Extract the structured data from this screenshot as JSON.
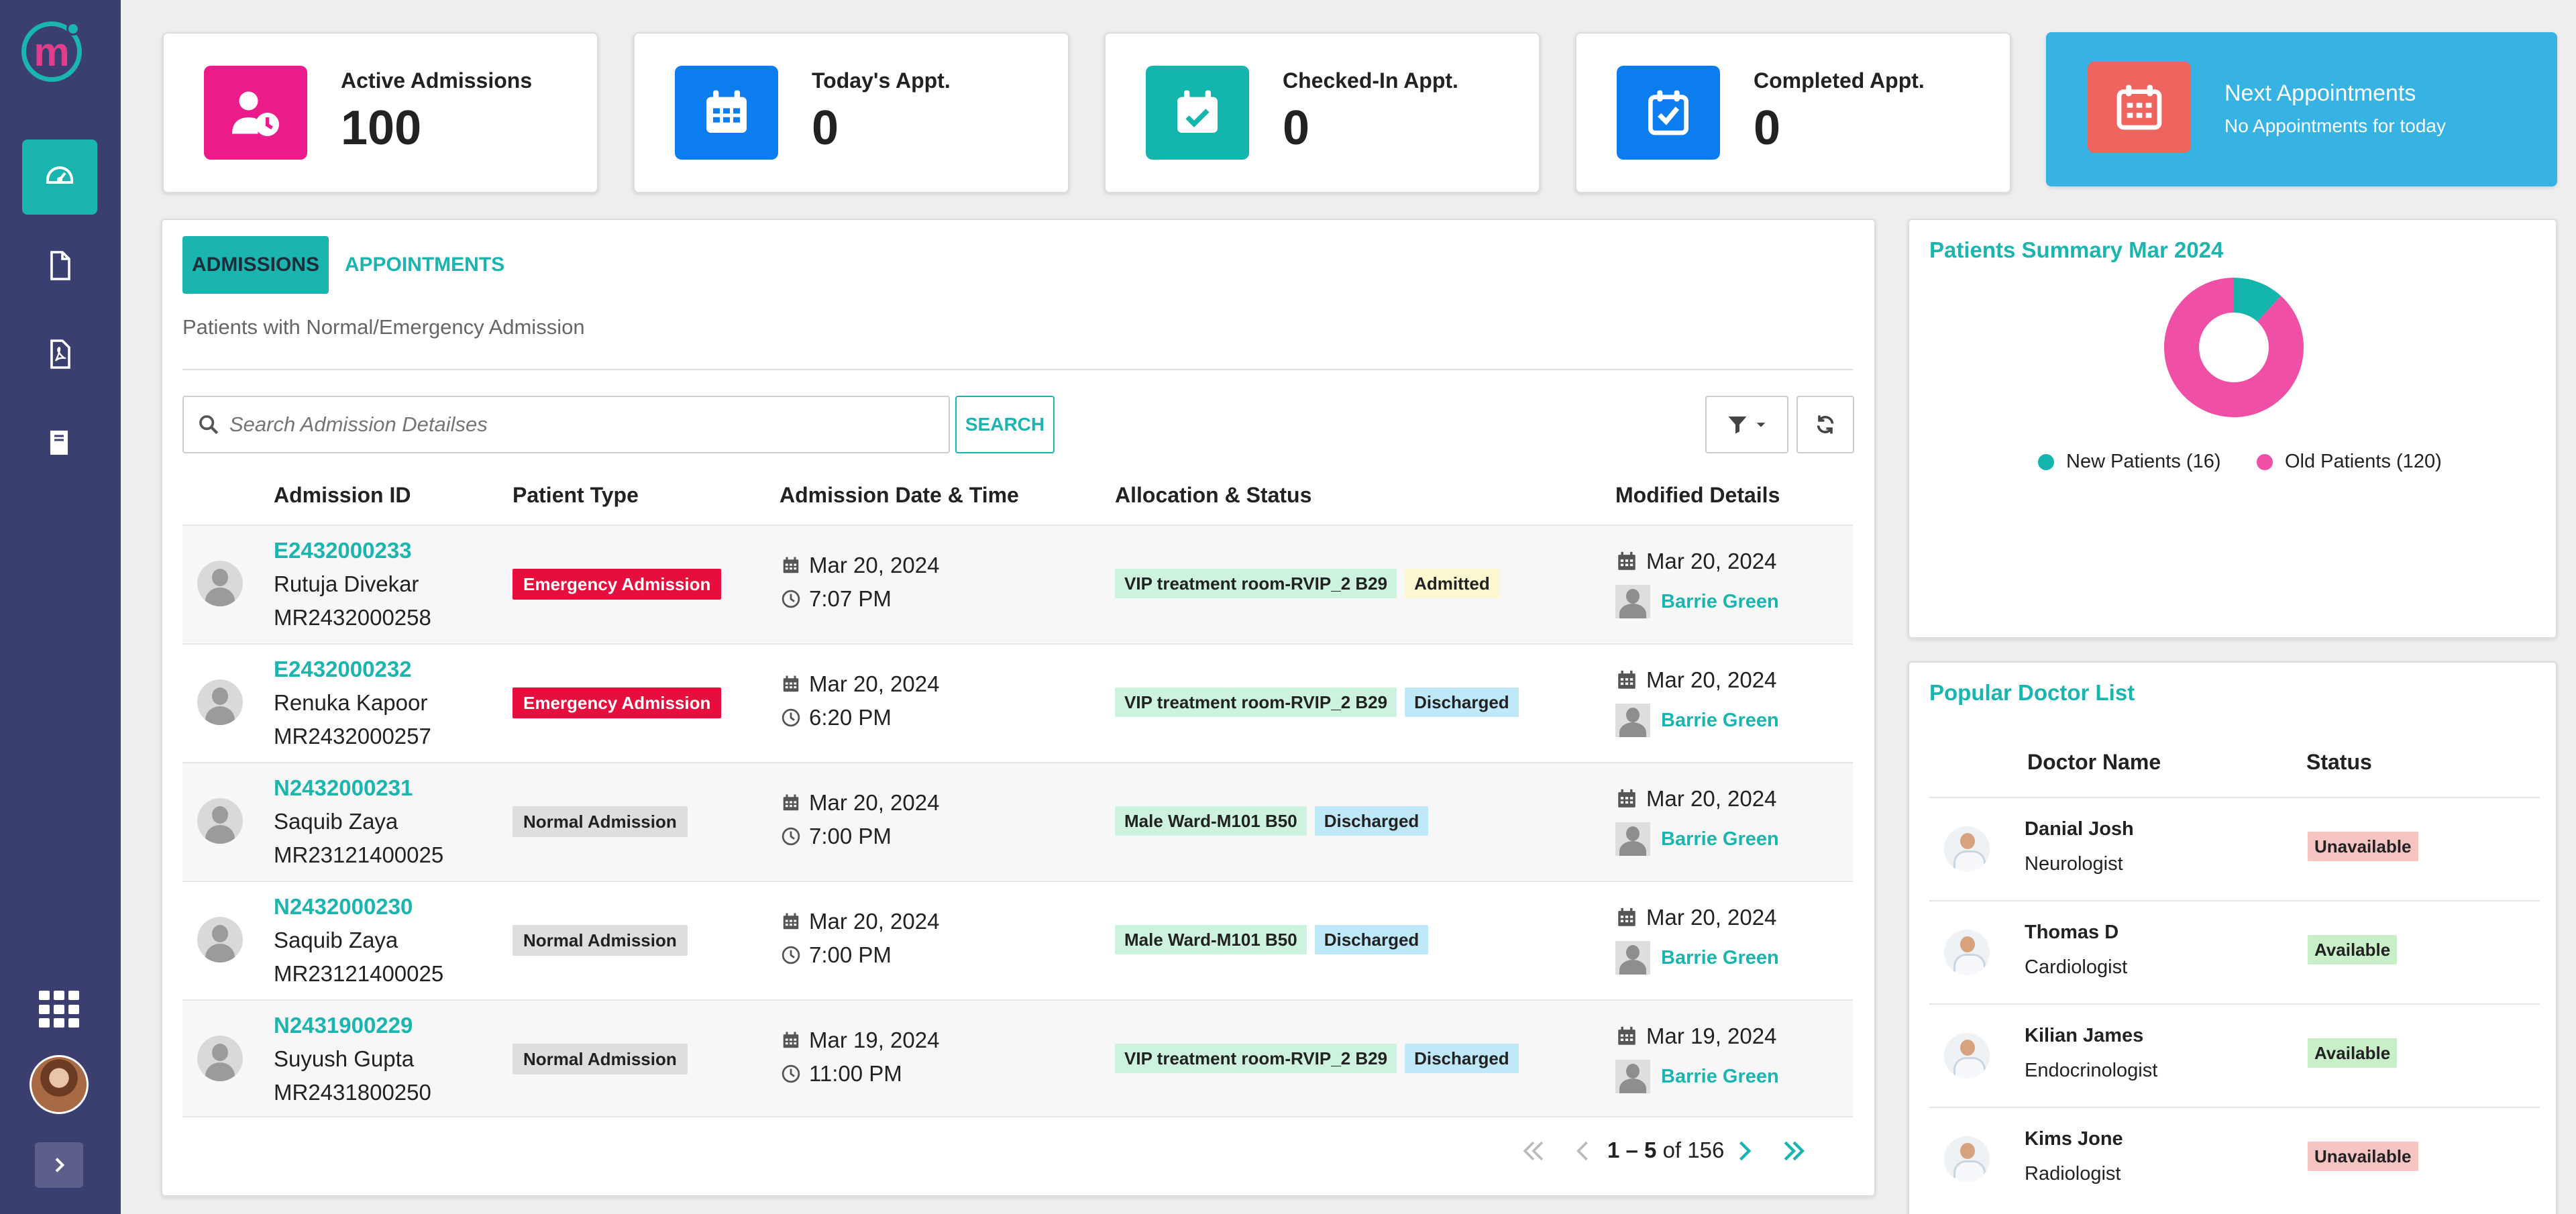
{
  "stats": [
    {
      "label": "Active Admissions",
      "value": "100",
      "color": "#ec1b8c",
      "icon": "user-clock-icon"
    },
    {
      "label": "Today's Appt.",
      "value": "0",
      "color": "#0b7dee",
      "icon": "calendar-icon"
    },
    {
      "label": "Checked-In Appt.",
      "value": "0",
      "color": "#14b5ac",
      "icon": "calendar-check-icon"
    },
    {
      "label": "Completed Appt.",
      "value": "0",
      "color": "#0b7dee",
      "icon": "checkbox-icon"
    }
  ],
  "next_appointments": {
    "title": "Next Appointments",
    "subtitle": "No Appointments for today",
    "color": "#36b3e3"
  },
  "tabs": {
    "admissions": "ADMISSIONS",
    "appointments": "APPOINTMENTS"
  },
  "panel_subtitle": "Patients with Normal/Emergency Admission",
  "search": {
    "placeholder": "Search Admission Detailses",
    "button": "SEARCH"
  },
  "table": {
    "headers": [
      "Admission ID",
      "Patient Type",
      "Admission Date & Time",
      "Allocation & Status",
      "Modified Details"
    ],
    "rows": [
      {
        "id": "E2432000233",
        "name": "Rutuja Divekar",
        "mrn": "MR2432000258",
        "type": "Emergency Admission",
        "date": "Mar 20, 2024",
        "time": "7:07 PM",
        "room": "VIP treatment room-RVIP_2 B29",
        "status": "Admitted",
        "mod_date": "Mar 20, 2024",
        "mod_user": "Barrie Green"
      },
      {
        "id": "E2432000232",
        "name": "Renuka Kapoor",
        "mrn": "MR2432000257",
        "type": "Emergency Admission",
        "date": "Mar 20, 2024",
        "time": "6:20 PM",
        "room": "VIP treatment room-RVIP_2 B29",
        "status": "Discharged",
        "mod_date": "Mar 20, 2024",
        "mod_user": "Barrie Green"
      },
      {
        "id": "N2432000231",
        "name": "Saquib Zaya",
        "mrn": "MR23121400025",
        "type": "Normal Admission",
        "date": "Mar 20, 2024",
        "time": "7:00 PM",
        "room": "Male Ward-M101 B50",
        "status": "Discharged",
        "mod_date": "Mar 20, 2024",
        "mod_user": "Barrie Green"
      },
      {
        "id": "N2432000230",
        "name": "Saquib Zaya",
        "mrn": "MR23121400025",
        "type": "Normal Admission",
        "date": "Mar 20, 2024",
        "time": "7:00 PM",
        "room": "Male Ward-M101 B50",
        "status": "Discharged",
        "mod_date": "Mar 20, 2024",
        "mod_user": "Barrie Green"
      },
      {
        "id": "N2431900229",
        "name": "Suyush Gupta",
        "mrn": "MR2431800250",
        "type": "Normal Admission",
        "date": "Mar 19, 2024",
        "time": "11:00 PM",
        "room": "VIP treatment room-RVIP_2 B29",
        "status": "Discharged",
        "mod_date": "Mar 19, 2024",
        "mod_user": "Barrie Green"
      }
    ]
  },
  "pagination": {
    "range": "1 – 5",
    "of": "of 156"
  },
  "patients_summary": {
    "title": "Patients Summary Mar 2024",
    "series": [
      {
        "name": "New Patients (16)",
        "value": 16,
        "color": "#14b5ac"
      },
      {
        "name": "Old Patients (120)",
        "value": 120,
        "color": "#f04fa6"
      }
    ]
  },
  "doctors": {
    "title": "Popular Doctor List",
    "headers": [
      "Doctor Name",
      "Status"
    ],
    "rows": [
      {
        "name": "Danial Josh",
        "specialty": "Neurologist",
        "status": "Unavailable"
      },
      {
        "name": "Thomas D",
        "specialty": "Cardiologist",
        "status": "Available"
      },
      {
        "name": "Kilian James",
        "specialty": "Endocrinologist",
        "status": "Available"
      },
      {
        "name": "Kims Jone",
        "specialty": "Radiologist",
        "status": "Unavailable"
      }
    ]
  },
  "colors": {
    "accent": "#1bb5b0",
    "sidebar": "#3b3f70",
    "emergency": "#e60e3c"
  }
}
